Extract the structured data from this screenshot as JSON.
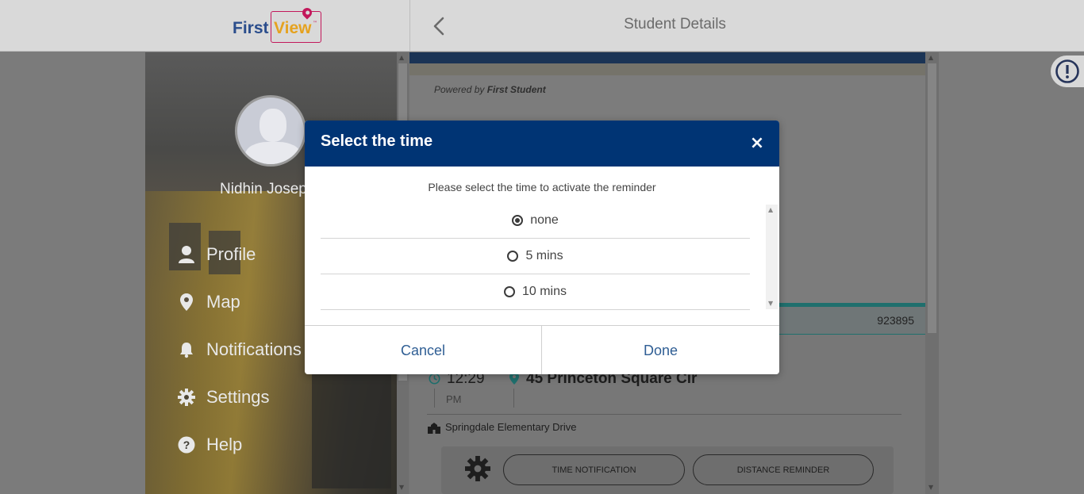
{
  "header": {
    "logo_first": "First",
    "logo_view": "View",
    "logo_tm": "™",
    "title": "Student Details"
  },
  "sidebar": {
    "user_name": "Nidhin Josep",
    "items": [
      {
        "label": "Profile",
        "icon": "person-icon"
      },
      {
        "label": "Map",
        "icon": "map-pin-icon"
      },
      {
        "label": "Notifications",
        "icon": "bell-icon"
      },
      {
        "label": "Settings",
        "icon": "gear-icon"
      },
      {
        "label": "Help",
        "icon": "help-circle-icon"
      }
    ]
  },
  "content": {
    "powered_prefix": "Powered by",
    "powered_brand": "First Student",
    "id_value": "923895",
    "time": "12:29",
    "ampm": "PM",
    "address": "45 Princeton Square Cir",
    "school": "Springdale Elementary Drive",
    "time_notification_label": "TIME NOTIFICATION",
    "distance_reminder_label": "DISTANCE REMINDER"
  },
  "modal": {
    "title": "Select the time",
    "close_glyph": "×",
    "subtitle": "Please select the time to activate the reminder",
    "options": [
      {
        "label": "none",
        "selected": true
      },
      {
        "label": "5 mins",
        "selected": false
      },
      {
        "label": "10 mins",
        "selected": false
      }
    ],
    "cancel_label": "Cancel",
    "done_label": "Done"
  },
  "colors": {
    "modal_header": "#003474",
    "brand_blue": "#2a4d8c",
    "brand_orange": "#e5a21f",
    "brand_pink": "#c2185b",
    "teal": "#1f6f6d",
    "button_text": "#2f5e94"
  }
}
